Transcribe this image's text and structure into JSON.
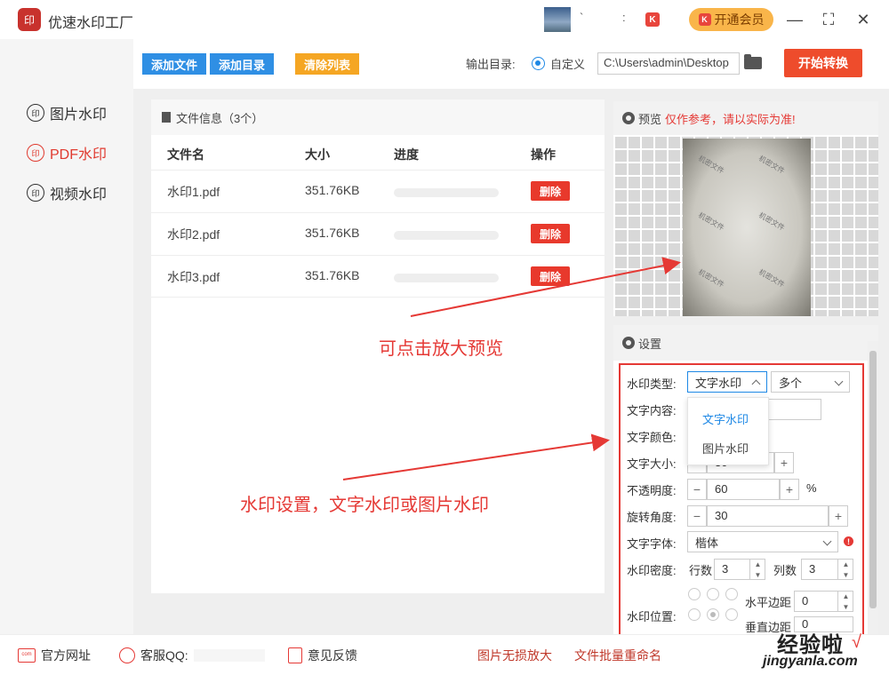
{
  "app": {
    "title": "优速水印工厂",
    "logo_text": "印",
    "user_name": "`",
    "user_tick": ":",
    "vip_badge": "K",
    "vip_label": "开通会员"
  },
  "window": {
    "min": "—",
    "max": "⛶",
    "close": "✕"
  },
  "sidebar": {
    "items": [
      {
        "icon": "印",
        "label": "图片水印",
        "active": false
      },
      {
        "icon": "印",
        "label": "PDF水印",
        "active": true
      },
      {
        "icon": "印",
        "label": "视频水印",
        "active": false
      }
    ]
  },
  "toolbar": {
    "add_file": "添加文件",
    "add_dir": "添加目录",
    "clear_list": "清除列表",
    "output_label": "输出目录:",
    "radio_label": "自定义",
    "path_value": "C:\\Users\\admin\\Desktop",
    "start": "开始转换",
    "colors": {
      "blue": "#2f8fe4",
      "orange": "#f5a623",
      "red": "#ee4c2c"
    }
  },
  "files": {
    "header": "文件信息（3个）",
    "columns": [
      "文件名",
      "大小",
      "进度",
      "操作"
    ],
    "rows": [
      {
        "name": "水印1.pdf",
        "size": "351.76KB",
        "progress": 0,
        "action": "删除"
      },
      {
        "name": "水印2.pdf",
        "size": "351.76KB",
        "progress": 0,
        "action": "删除"
      },
      {
        "name": "水印3.pdf",
        "size": "351.76KB",
        "progress": 0,
        "action": "删除"
      }
    ]
  },
  "preview": {
    "title": "预览",
    "warning": "仅作参考，请以实际为准!",
    "watermark_text": "机密文件"
  },
  "settings": {
    "title": "设置",
    "type_label": "水印类型:",
    "type_value": "文字水印",
    "multi_value": "多个",
    "type_options": [
      "文字水印",
      "图片水印"
    ],
    "text_label": "文字内容:",
    "color_label": "文字颜色:",
    "size_label": "文字大小:",
    "size_value": "30",
    "opacity_label": "不透明度:",
    "opacity_value": "60",
    "opacity_unit": "%",
    "rotate_label": "旋转角度:",
    "rotate_value": "30",
    "font_label": "文字字体:",
    "font_value": "楷体",
    "density_label": "水印密度:",
    "rows_label": "行数",
    "rows_value": "3",
    "cols_label": "列数",
    "cols_value": "3",
    "position_label": "水印位置:",
    "h_margin_label": "水平边距",
    "h_margin_value": "0",
    "v_margin_label": "垂直边距",
    "v_margin_value": "0",
    "minus": "−",
    "plus": "+",
    "error_mark": "!"
  },
  "annotations": {
    "preview_hint": "可点击放大预览",
    "settings_hint": "水印设置，文字水印或图片水印"
  },
  "footer": {
    "website": "官方网址",
    "website_icon": "com",
    "qq": "客服QQ:",
    "feedback": "意见反馈",
    "link1": "图片无损放大",
    "link2": "文件批量重命名"
  },
  "brand": {
    "name": "经验啦",
    "url": "jingyanla.com",
    "tick": "√"
  }
}
